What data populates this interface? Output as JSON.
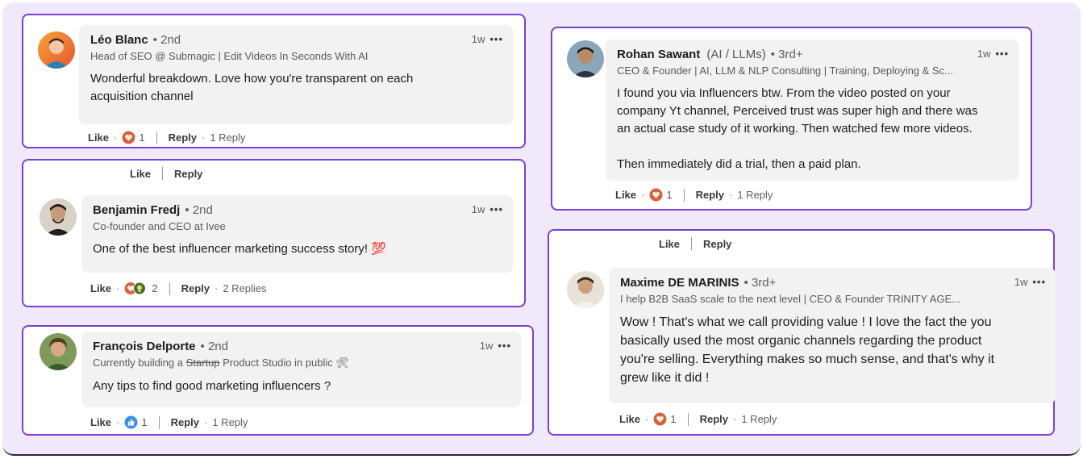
{
  "comments": [
    {
      "name": "Léo Blanc",
      "degree": "• 2nd",
      "headline": "Head of SEO @ Submagic | Edit Videos In Seconds With AI",
      "text": "Wonderful breakdown. Love how you're transparent on each\nacquisition channel",
      "time": "1w",
      "menu": "•••",
      "like": "Like",
      "reaction_count": "1",
      "reply": "Reply",
      "replies": "1 Reply",
      "reaction_icon": "heart-reaction-icon"
    },
    {
      "parent_like": "Like",
      "parent_reply": "Reply",
      "name": "Benjamin Fredj",
      "degree": "• 2nd",
      "headline": "Co-founder and CEO at Ivee",
      "text": "One of the best influencer marketing success story! 💯",
      "time": "1w",
      "menu": "•••",
      "like": "Like",
      "reaction_count": "2",
      "reply": "Reply",
      "replies": "2 Replies",
      "reaction_icon": "heart-and-insightful-reaction-icon"
    },
    {
      "name": "François Delporte",
      "degree": "• 2nd",
      "headline_pre": "Currently building a ",
      "headline_strike": "Startup",
      "headline_post": " Product Studio in public 🛠",
      "text": "Any tips to find good marketing influencers ?",
      "time": "1w",
      "menu": "•••",
      "like": "Like",
      "reaction_count": "1",
      "reply": "Reply",
      "replies": "1 Reply",
      "reaction_icon": "thumbs-up-reaction-icon"
    },
    {
      "name": "Rohan Sawant",
      "pronouns": "(AI / LLMs)",
      "degree": "• 3rd+",
      "headline": "CEO & Founder | AI, LLM & NLP Consulting | Training, Deploying & Sc...",
      "text": "I found you via Influencers btw. From the video posted on your\ncompany Yt channel, Perceived trust was super high and there was\nan actual case study of it working. Then watched few more videos.\n\nThen immediately did a trial, then a paid plan.",
      "time": "1w",
      "menu": "•••",
      "like": "Like",
      "reaction_count": "1",
      "reply": "Reply",
      "replies": "1 Reply",
      "reaction_icon": "heart-reaction-icon"
    },
    {
      "parent_like": "Like",
      "parent_reply": "Reply",
      "name": "Maxime DE MARINIS",
      "degree": "• 3rd+",
      "headline": "I help B2B SaaS scale to the next level | CEO & Founder TRINITY AGE...",
      "text": "Wow ! That's what we call providing value ! I love the fact the you\nbasically used the most organic channels regarding the product\nyou're selling. Everything makes so much sense, and that's why it\ngrew like it did !",
      "time": "1w",
      "menu": "•••",
      "like": "Like",
      "reaction_count": "1",
      "reply": "Reply",
      "replies": "1 Reply",
      "reaction_icon": "heart-reaction-icon"
    }
  ],
  "colors": {
    "card_border": "#7b3fd6",
    "background": "#efe9fb",
    "bubble": "#f2f2f2",
    "heart_reaction": "#d9603b",
    "like_reaction": "#378fe9",
    "insightful_reaction": "#44712e"
  }
}
